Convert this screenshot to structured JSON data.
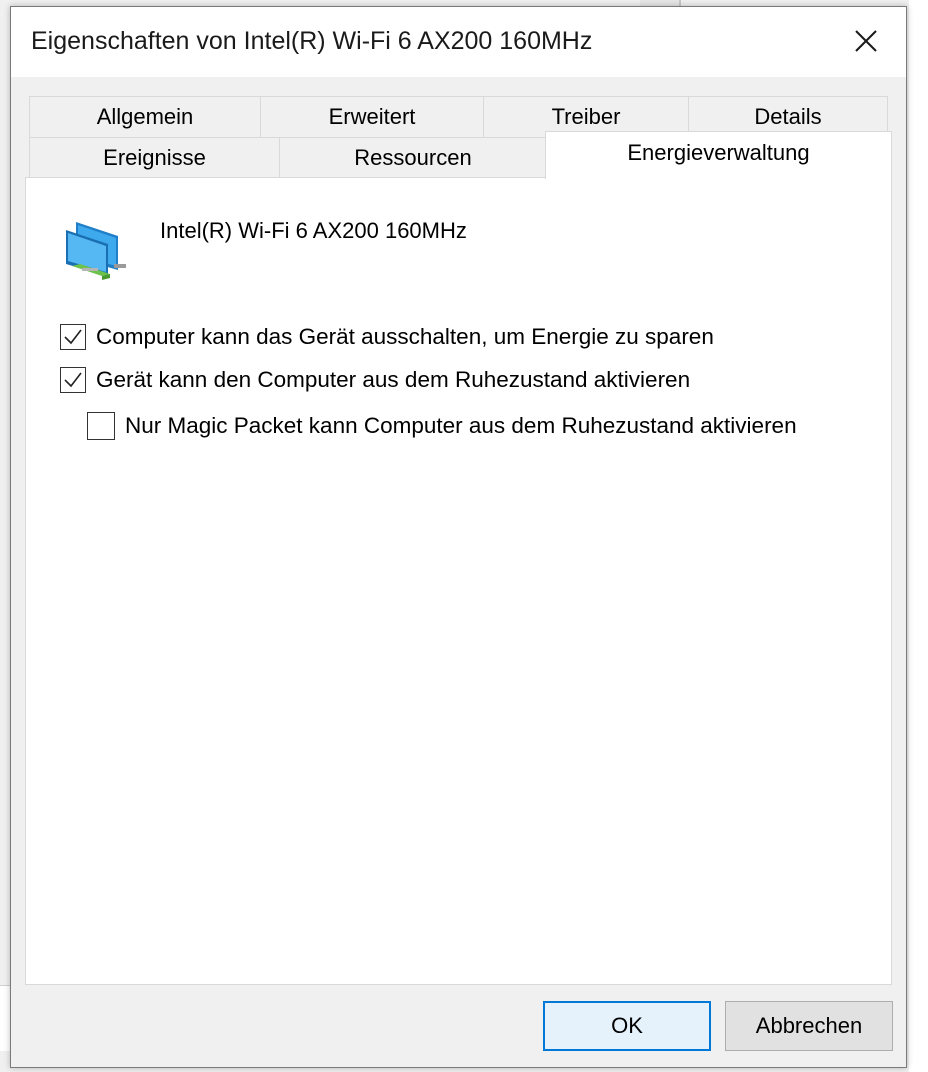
{
  "window": {
    "title": "Eigenschaften von Intel(R) Wi-Fi 6 AX200 160MHz"
  },
  "tabs_row1": [
    {
      "label": "Allgemein"
    },
    {
      "label": "Erweitert"
    },
    {
      "label": "Treiber"
    },
    {
      "label": "Details"
    }
  ],
  "tabs_row2": [
    {
      "label": "Ereignisse"
    },
    {
      "label": "Ressourcen"
    },
    {
      "label": "Energieverwaltung",
      "active": true
    }
  ],
  "device": {
    "name": "Intel(R) Wi-Fi 6 AX200 160MHz",
    "icon": "network-adapter-icon"
  },
  "options": [
    {
      "label": "Computer kann das Gerät ausschalten, um Energie zu sparen",
      "checked": true
    },
    {
      "label": "Gerät kann den Computer aus dem Ruhezustand aktivieren",
      "checked": true
    },
    {
      "label": "Nur Magic Packet kann Computer aus dem Ruhezustand aktivieren",
      "checked": false
    }
  ],
  "buttons": {
    "ok": "OK",
    "cancel": "Abbrechen"
  },
  "colors": {
    "accent": "#0078d7",
    "panel": "#ffffff",
    "chrome": "#f0f0f0"
  }
}
